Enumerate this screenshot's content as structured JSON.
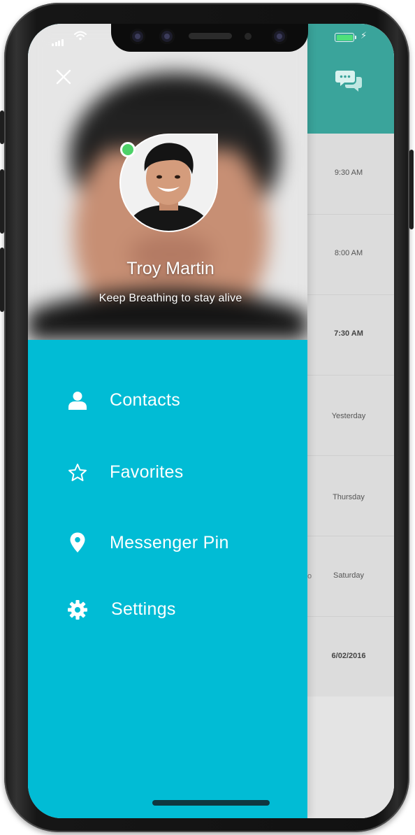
{
  "profile": {
    "name": "Troy Martin",
    "status": "Keep Breathing to stay alive",
    "online": true
  },
  "menu": {
    "items": [
      {
        "label": "Contacts",
        "icon": "person-icon"
      },
      {
        "label": "Favorites",
        "icon": "star-icon"
      },
      {
        "label": "Messenger Pin",
        "icon": "location-pin-icon"
      },
      {
        "label": "Settings",
        "icon": "gear-icon"
      }
    ]
  },
  "background_chat_list": {
    "times": [
      "9:30 AM",
      "8:00 AM",
      "7:30 AM",
      "Yesterday",
      "Thursday",
      "Saturday",
      "6/02/2016"
    ],
    "partial_text": "o"
  },
  "colors": {
    "drawer": "#01bcd5",
    "header_accent": "#3aa49b",
    "online": "#4dd168",
    "battery": "#4fe07a"
  },
  "status_bar": {
    "signal_icon": "signal-icon",
    "wifi_icon": "wifi-icon",
    "battery_icon": "battery-charging-icon"
  }
}
